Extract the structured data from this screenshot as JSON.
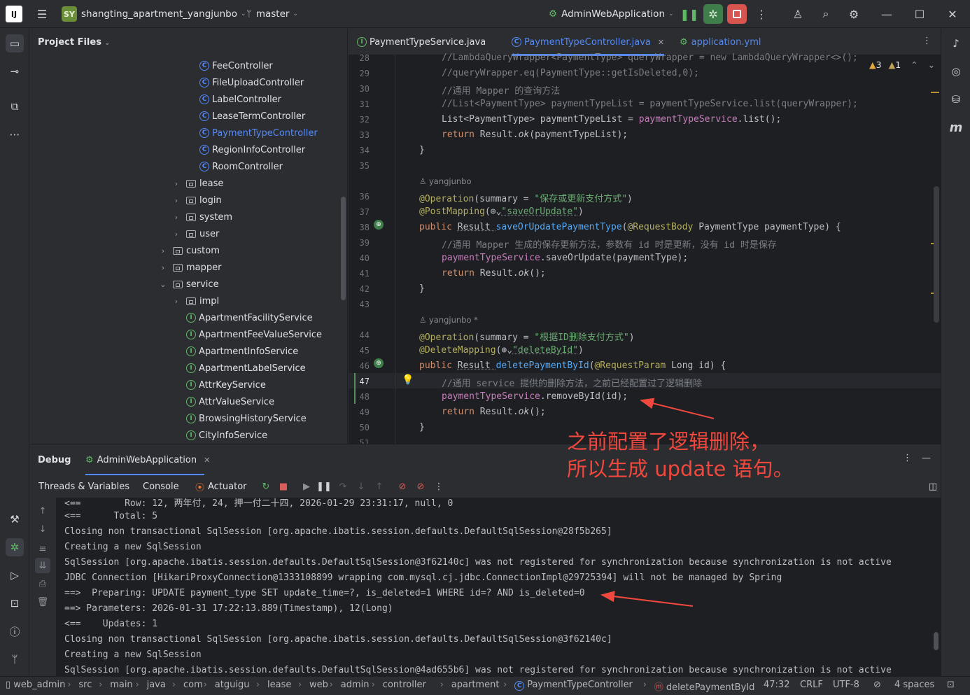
{
  "titlebar": {
    "project_badge": "SY",
    "project_name": "shangting_apartment_yangjunbo",
    "branch": "master",
    "run_config": "AdminWebApplication"
  },
  "project_panel": {
    "title": "Project Files",
    "items": [
      {
        "label": "FeeController",
        "kind": "class"
      },
      {
        "label": "FileUploadController",
        "kind": "class"
      },
      {
        "label": "LabelController",
        "kind": "class"
      },
      {
        "label": "LeaseTermController",
        "kind": "class"
      },
      {
        "label": "PaymentTypeController",
        "kind": "class",
        "selected": true
      },
      {
        "label": "RegionInfoController",
        "kind": "class"
      },
      {
        "label": "RoomController",
        "kind": "class"
      },
      {
        "label": "lease",
        "kind": "folder",
        "state": "collapsed"
      },
      {
        "label": "login",
        "kind": "folder",
        "state": "collapsed"
      },
      {
        "label": "system",
        "kind": "folder",
        "state": "collapsed"
      },
      {
        "label": "user",
        "kind": "folder",
        "state": "collapsed"
      },
      {
        "label": "custom",
        "kind": "folder",
        "state": "collapsed"
      },
      {
        "label": "mapper",
        "kind": "folder",
        "state": "collapsed"
      },
      {
        "label": "service",
        "kind": "folder",
        "state": "expanded"
      },
      {
        "label": "impl",
        "kind": "folder",
        "state": "collapsed"
      },
      {
        "label": "ApartmentFacilityService",
        "kind": "interface"
      },
      {
        "label": "ApartmentFeeValueService",
        "kind": "interface"
      },
      {
        "label": "ApartmentInfoService",
        "kind": "interface"
      },
      {
        "label": "ApartmentLabelService",
        "kind": "interface"
      },
      {
        "label": "AttrKeyService",
        "kind": "interface"
      },
      {
        "label": "AttrValueService",
        "kind": "interface"
      },
      {
        "label": "BrowsingHistoryService",
        "kind": "interface"
      },
      {
        "label": "CityInfoService",
        "kind": "interface"
      }
    ]
  },
  "editor": {
    "tabs": [
      {
        "label": "PaymentTypeService.java",
        "icon": "interface-icon",
        "active": false
      },
      {
        "label": "PaymentTypeController.java",
        "icon": "class-icon",
        "active": true
      },
      {
        "label": "application.yml",
        "icon": "yaml-icon",
        "active": false
      }
    ],
    "warnings": "3",
    "weak_warnings": "1",
    "cursor_line": "47",
    "author_1": "yangjunbo",
    "author_2": "yangjunbo *",
    "line_numbers": [
      "28",
      "29",
      "30",
      "31",
      "32",
      "33",
      "34",
      "35",
      "36",
      "37",
      "38",
      "39",
      "40",
      "41",
      "42",
      "43",
      "44",
      "45",
      "46",
      "47",
      "48",
      "49",
      "50",
      "51"
    ],
    "code": {
      "l28": "//LambdaQueryWrapper<PaymentType> queryWrapper = new LambdaQueryWrapper<>();",
      "l29": "//queryWrapper.eq(PaymentType::getIsDeleted,0);",
      "l30": "//通用 Mapper 的查询方法",
      "l31": "//List<PaymentType> paymentTypeList = paymentTypeService.list(queryWrapper);",
      "l32a": "List<PaymentType> paymentTypeList = ",
      "l32b": "paymentTypeService",
      "l32c": ".list();",
      "l33a": "return ",
      "l33b": "Result.",
      "l33c": "ok",
      "l33d": "(paymentTypeList);",
      "l34": "}",
      "l36a": "@Operation",
      "l36b": "(summary = ",
      "l36c": "\"保存或更新支付方式\"",
      "l36d": ")",
      "l37a": "@PostMapping",
      "l37b": "(⊕⌄",
      "l37c": "\"saveOrUpdate\"",
      "l37d": ")",
      "l38a": "public ",
      "l38b": "Result ",
      "l38c": "saveOrUpdatePaymentType",
      "l38d": "(",
      "l38e": "@RequestBody ",
      "l38f": "PaymentType paymentType) {",
      "l39": "//通用 Mapper 生成的保存更新方法，参数有 id 时是更新，没有 id 时是保存",
      "l40a": "paymentTypeService",
      "l40b": ".saveOrUpdate(paymentType);",
      "l41a": "return ",
      "l41b": "Result.",
      "l41c": "ok",
      "l41d": "();",
      "l42": "}",
      "l44a": "@Operation",
      "l44b": "(summary = ",
      "l44c": "\"根据ID删除支付方式\"",
      "l44d": ")",
      "l45a": "@DeleteMapping",
      "l45b": "(⊕⌄",
      "l45c": "\"deleteById\"",
      "l45d": ")",
      "l46a": "public ",
      "l46b": "Result ",
      "l46c": "deletePaymentById",
      "l46d": "(",
      "l46e": "@RequestParam ",
      "l46f": "Long id) {",
      "l47": "//通用 service 提供的删除方法，之前已经配置过了逻辑删除",
      "l48a": "paymentTypeService",
      "l48b": ".removeById(id);",
      "l49a": "return ",
      "l49b": "Result.",
      "l49c": "ok",
      "l49d": "();",
      "l50": "}"
    }
  },
  "debug": {
    "title": "Debug",
    "session": "AdminWebApplication",
    "subtabs": [
      "Threads & Variables",
      "Console",
      "Actuator"
    ],
    "console_lines": [
      "<==        Row: 12, 两年付, 24, 押一付二十四, 2026-01-29 23:31:17, null, 0",
      "<==      Total: 5",
      "Closing non transactional SqlSession [org.apache.ibatis.session.defaults.DefaultSqlSession@28f5b265]",
      "Creating a new SqlSession",
      "SqlSession [org.apache.ibatis.session.defaults.DefaultSqlSession@3f62140c] was not registered for synchronization because synchronization is not active",
      "JDBC Connection [HikariProxyConnection@1333108899 wrapping com.mysql.cj.jdbc.ConnectionImpl@29725394] will not be managed by Spring",
      "==>  Preparing: UPDATE payment_type SET update_time=?, is_deleted=1 WHERE id=? AND is_deleted=0",
      "==> Parameters: 2026-01-31 17:22:13.889(Timestamp), 12(Long)",
      "<==    Updates: 1",
      "Closing non transactional SqlSession [org.apache.ibatis.session.defaults.DefaultSqlSession@3f62140c]",
      "Creating a new SqlSession",
      "SqlSession [org.apache.ibatis.session.defaults.DefaultSqlSession@4ad655b6] was not registered for synchronization because synchronization is not active"
    ]
  },
  "annotation": {
    "text": "之前配置了逻辑删除，\n所以生成 update 语句。",
    "color": "#f0483e"
  },
  "statusbar": {
    "breadcrumbs": [
      "web_admin",
      "src",
      "main",
      "java",
      "com",
      "atguigu",
      "lease",
      "web",
      "admin",
      "controller",
      "apartment",
      "PaymentTypeController",
      "deletePaymentById"
    ],
    "position": "47:32",
    "line_sep": "CRLF",
    "encoding": "UTF-8",
    "indent": "4 spaces"
  },
  "colors": {
    "accent": "#548af7",
    "editor_bg": "#1e1f22",
    "panel_bg": "#2b2d30",
    "stop": "#db5c5c",
    "run": "#5fb865"
  }
}
